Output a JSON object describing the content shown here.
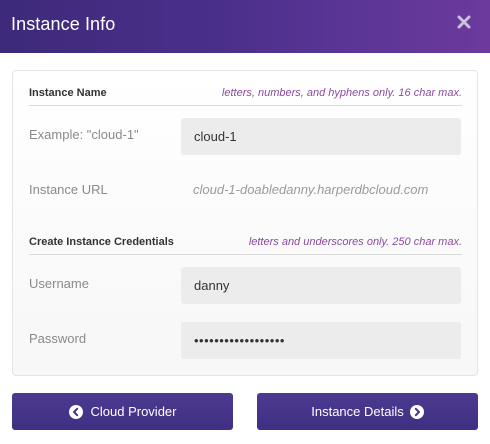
{
  "header": {
    "title": "Instance Info",
    "close_icon": "close-icon"
  },
  "sections": {
    "instance_name": {
      "title": "Instance Name",
      "hint": "letters, numbers, and hyphens only. 16 char max."
    },
    "credentials": {
      "title": "Create Instance Credentials",
      "hint": "letters and underscores only. 250 char max."
    }
  },
  "fields": {
    "instance_name": {
      "label": "Example: \"cloud-1\"",
      "value": "cloud-1"
    },
    "instance_url": {
      "label": "Instance URL",
      "value": "cloud-1-doabledanny.harperdbcloud.com"
    },
    "username": {
      "label": "Username",
      "value": "danny"
    },
    "password": {
      "label": "Password",
      "value": "••••••••••••••••••"
    }
  },
  "buttons": {
    "back": {
      "label": "Cloud Provider",
      "icon": "chevron-left-circle-icon"
    },
    "next": {
      "label": "Instance Details",
      "icon": "chevron-right-circle-icon"
    }
  },
  "colors": {
    "header_gradient_start": "#3d2a7a",
    "header_gradient_end": "#6b3a9c",
    "hint_text": "#8a4a9f",
    "button_bg": "#46348a"
  }
}
